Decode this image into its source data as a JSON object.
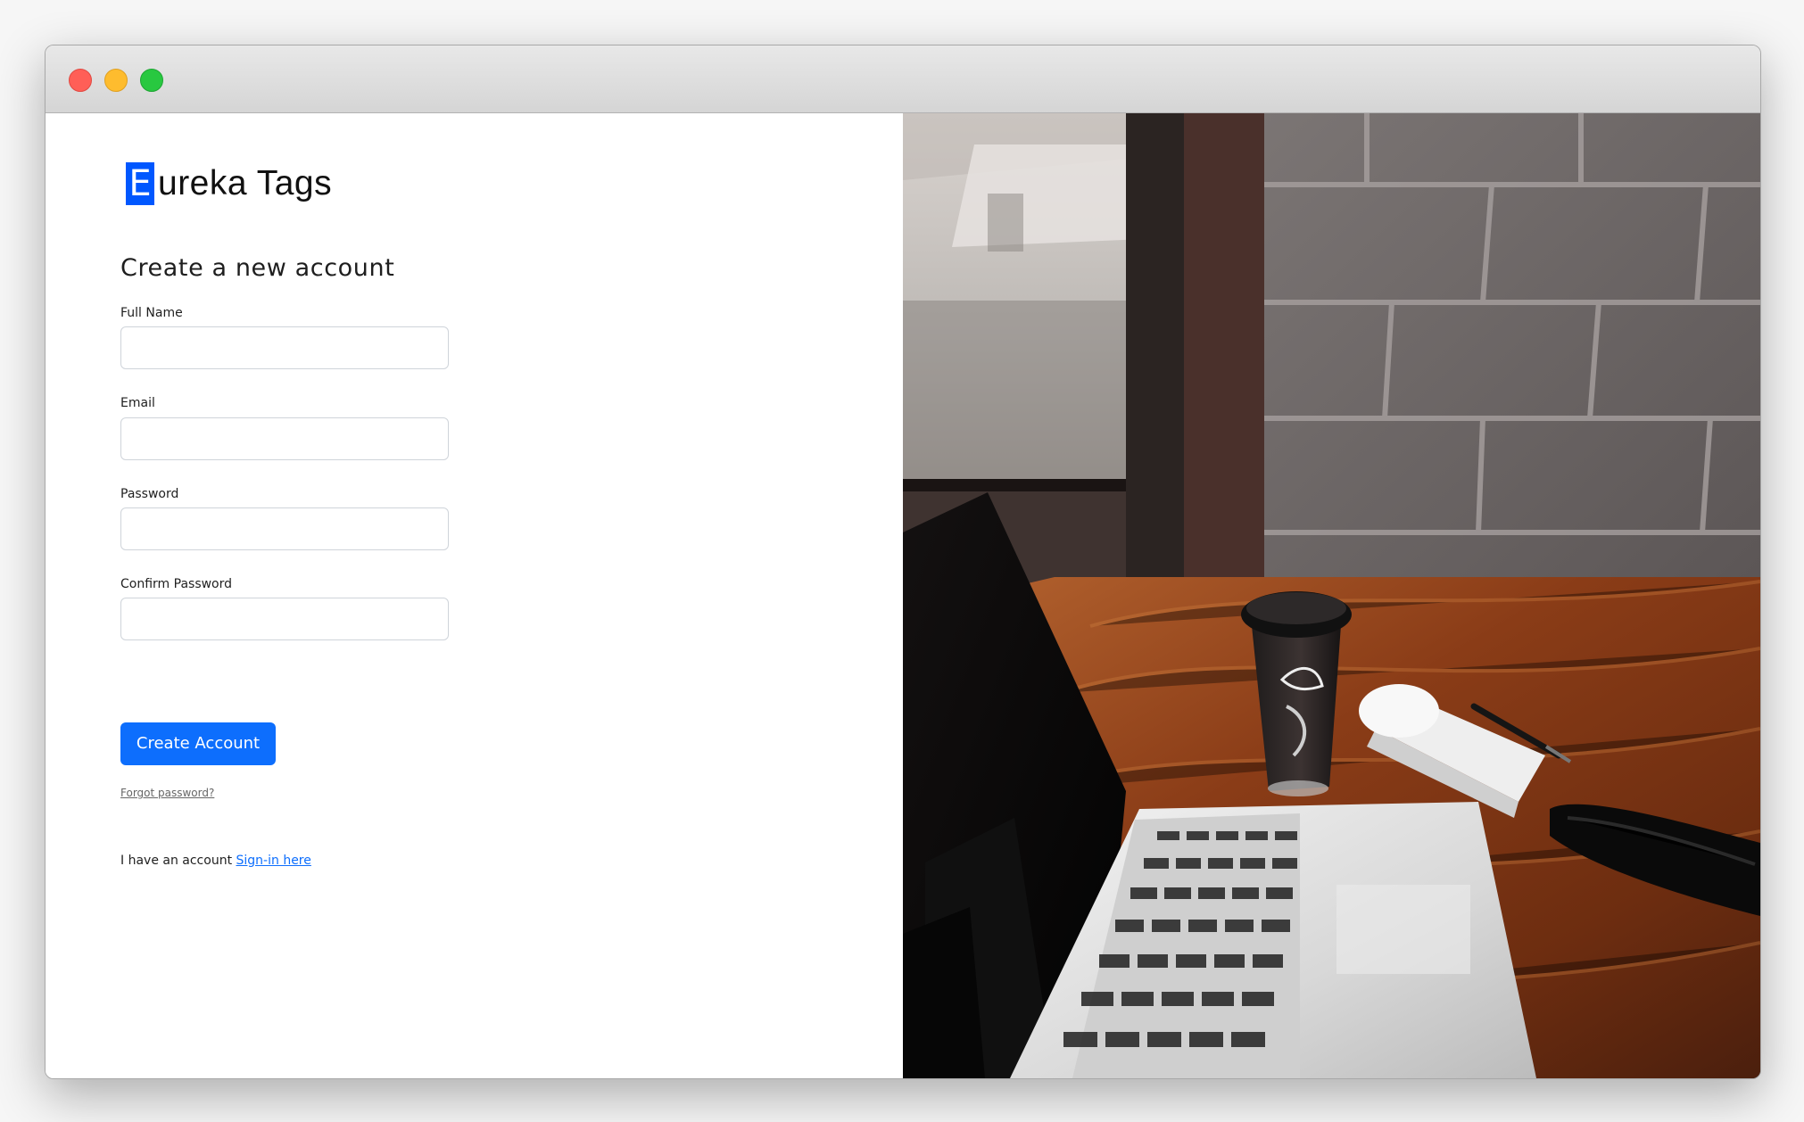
{
  "window": {
    "controls": [
      "close",
      "minimize",
      "maximize"
    ]
  },
  "brand": {
    "logo_initial": "E",
    "logo_rest": "ureka Tags",
    "accent": "#0057ff"
  },
  "form": {
    "title": "Create a new account",
    "fields": [
      {
        "label": "Full Name",
        "value": "",
        "placeholder": ""
      },
      {
        "label": "Email",
        "value": "",
        "placeholder": ""
      },
      {
        "label": "Password",
        "value": "",
        "placeholder": ""
      },
      {
        "label": "Confirm Password",
        "value": "",
        "placeholder": ""
      }
    ],
    "submit_label": "Create Account",
    "forgot_password": "Forgot password?",
    "account_prompt": "I have an account",
    "signin_link": "Sign-in here"
  },
  "hero": {
    "image": "laptop-coffee-desk-photo",
    "colors": {
      "button": "#0d6efd",
      "wood": "#9b4a1f",
      "wall": "#6e6766"
    }
  }
}
